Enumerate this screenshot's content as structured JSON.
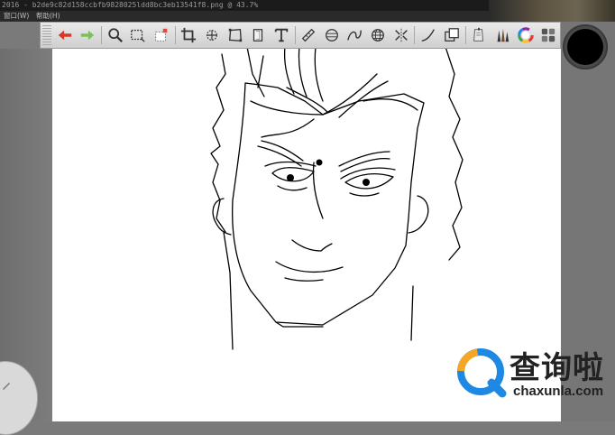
{
  "window": {
    "title": "2016 - b2de9c82d158ccbfb9828025ldd8bc3eb13541f8.png @ 43.7%"
  },
  "menu": {
    "items": [
      "窗口(W)",
      "帮助(H)"
    ]
  },
  "toolbar": {
    "tools": [
      {
        "name": "undo-icon",
        "color": "#d33a2a"
      },
      {
        "name": "redo-icon",
        "color": "#7fbf5a"
      },
      {
        "name": "zoom-icon"
      },
      {
        "name": "rect-select-icon"
      },
      {
        "name": "lasso-select-icon"
      },
      {
        "name": "crop-icon"
      },
      {
        "name": "transform-icon"
      },
      {
        "name": "perspective-icon"
      },
      {
        "name": "layer-icon"
      },
      {
        "name": "text-icon"
      },
      {
        "name": "ruler-icon"
      },
      {
        "name": "ellipse-guide-icon"
      },
      {
        "name": "curve-guide-icon"
      },
      {
        "name": "sphere-guide-icon"
      },
      {
        "name": "symmetry-icon"
      },
      {
        "name": "stroke-icon"
      },
      {
        "name": "fill-icon"
      },
      {
        "name": "copic-icon"
      },
      {
        "name": "brush-library-icon"
      },
      {
        "name": "color-wheel-icon"
      },
      {
        "name": "swatches-icon"
      }
    ]
  },
  "brush": {
    "color": "#000000"
  },
  "watermark": {
    "title": "查询啦",
    "url": "chaxunla.com",
    "accent": "#1e88e5",
    "accent2": "#f5a623"
  }
}
